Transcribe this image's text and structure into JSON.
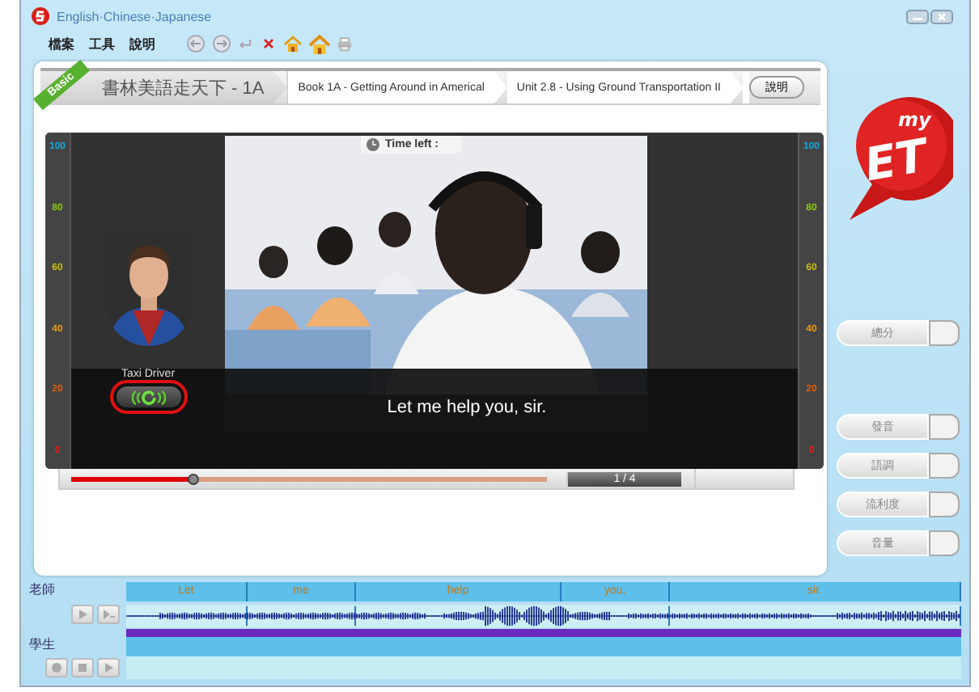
{
  "window": {
    "title": "English·Chinese·Japanese"
  },
  "menu": [
    {
      "label": "檔案"
    },
    {
      "label": "工具"
    },
    {
      "label": "說明"
    }
  ],
  "breadcrumb": {
    "badge": "Basic",
    "items": [
      "書林美語走天下 - 1A",
      "Book 1A - Getting Around in Americal",
      "Unit 2.8 - Using Ground Transportation II"
    ],
    "button": "說明"
  },
  "video": {
    "scale_left": [
      {
        "label": "100",
        "color": "#1aa6d8"
      },
      {
        "label": "80",
        "color": "#8ccc12"
      },
      {
        "label": "60",
        "color": "#c8c010"
      },
      {
        "label": "40",
        "color": "#e89a10"
      },
      {
        "label": "20",
        "color": "#e06010"
      },
      {
        "label": "0",
        "color": "#e02020"
      }
    ],
    "scale_right": [
      {
        "label": "100",
        "color": "#1aa6d8"
      },
      {
        "label": "80",
        "color": "#8ccc12"
      },
      {
        "label": "60",
        "color": "#c8c010"
      },
      {
        "label": "40",
        "color": "#e89a10"
      },
      {
        "label": "20",
        "color": "#e06010"
      },
      {
        "label": "0",
        "color": "#e02020"
      }
    ],
    "timer": {
      "label": "Time left :"
    },
    "speaker": {
      "role": "Taxi Driver",
      "replay_highlighted": true
    },
    "subtitle": "Let me help you, sir.",
    "progress": {
      "level": 0.26,
      "counter": "1 / 4"
    }
  },
  "logo": {
    "small": "my",
    "large": "ET"
  },
  "scores": [
    {
      "label": "總分"
    },
    {
      "label": "發音"
    },
    {
      "label": "語調"
    },
    {
      "label": "流利度"
    },
    {
      "label": "音量"
    }
  ],
  "recorder": {
    "teacher": {
      "label": "老師",
      "words": [
        "Let",
        "me",
        "help",
        "you,",
        "sir."
      ]
    },
    "student": {
      "label": "學生"
    }
  }
}
